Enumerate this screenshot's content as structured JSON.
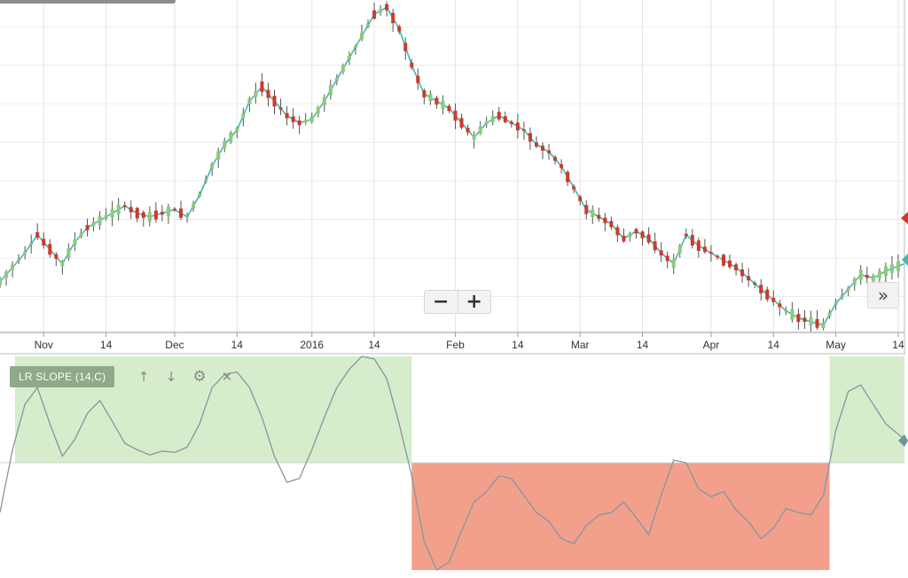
{
  "chart_data": [
    {
      "type": "candlestick",
      "ylim": [
        6,
        98
      ],
      "xlim": [
        0,
        145
      ],
      "grid": true,
      "x_ticks": [
        {
          "label": "Nov",
          "x": 7
        },
        {
          "label": "14",
          "x": 17
        },
        {
          "label": "Dec",
          "x": 28
        },
        {
          "label": "14",
          "x": 38
        },
        {
          "label": "2016",
          "x": 50
        },
        {
          "label": "14",
          "x": 60
        },
        {
          "label": "Feb",
          "x": 73
        },
        {
          "label": "14",
          "x": 83
        },
        {
          "label": "Mar",
          "x": 93
        },
        {
          "label": "14",
          "x": 103
        },
        {
          "label": "Apr",
          "x": 114
        },
        {
          "label": "14",
          "x": 124
        },
        {
          "label": "May",
          "x": 134
        },
        {
          "label": "14",
          "x": 144
        }
      ],
      "close_points": [
        [
          0,
          20
        ],
        [
          2,
          24
        ],
        [
          4,
          28
        ],
        [
          6,
          33
        ],
        [
          8,
          29
        ],
        [
          10,
          25
        ],
        [
          12,
          31
        ],
        [
          14,
          35
        ],
        [
          16,
          37
        ],
        [
          18,
          39
        ],
        [
          20,
          41
        ],
        [
          22,
          39
        ],
        [
          24,
          38
        ],
        [
          26,
          39
        ],
        [
          28,
          40
        ],
        [
          30,
          38
        ],
        [
          32,
          44
        ],
        [
          34,
          52
        ],
        [
          36,
          58
        ],
        [
          38,
          62
        ],
        [
          40,
          70
        ],
        [
          42,
          74
        ],
        [
          44,
          70
        ],
        [
          46,
          66
        ],
        [
          48,
          64
        ],
        [
          50,
          65
        ],
        [
          52,
          70
        ],
        [
          54,
          76
        ],
        [
          56,
          82
        ],
        [
          58,
          88
        ],
        [
          60,
          94
        ],
        [
          62,
          96
        ],
        [
          64,
          90
        ],
        [
          66,
          80
        ],
        [
          68,
          72
        ],
        [
          70,
          70
        ],
        [
          72,
          68
        ],
        [
          74,
          64
        ],
        [
          76,
          60
        ],
        [
          78,
          64
        ],
        [
          80,
          66
        ],
        [
          82,
          64
        ],
        [
          84,
          62
        ],
        [
          86,
          58
        ],
        [
          88,
          56
        ],
        [
          90,
          52
        ],
        [
          92,
          46
        ],
        [
          94,
          40
        ],
        [
          96,
          38
        ],
        [
          98,
          36
        ],
        [
          100,
          32
        ],
        [
          102,
          34
        ],
        [
          104,
          32
        ],
        [
          106,
          28
        ],
        [
          108,
          25
        ],
        [
          110,
          33
        ],
        [
          112,
          30
        ],
        [
          114,
          28
        ],
        [
          116,
          26
        ],
        [
          118,
          24
        ],
        [
          120,
          21
        ],
        [
          122,
          18
        ],
        [
          124,
          15
        ],
        [
          126,
          12
        ],
        [
          128,
          10
        ],
        [
          130,
          9
        ],
        [
          132,
          8
        ],
        [
          134,
          14
        ],
        [
          136,
          18
        ],
        [
          138,
          22
        ],
        [
          140,
          21
        ],
        [
          142,
          23
        ],
        [
          145,
          25
        ]
      ],
      "indicator": {
        "zero_line": 0,
        "ylim": [
          -82,
          82
        ],
        "green_band": {
          "from": 0,
          "to": 82
        },
        "red_band": {
          "from": 0,
          "to": -82
        },
        "red_period": [
          66,
          133
        ],
        "points": [
          [
            0,
            -38
          ],
          [
            2,
            10
          ],
          [
            4,
            45
          ],
          [
            6,
            58
          ],
          [
            8,
            30
          ],
          [
            10,
            5
          ],
          [
            12,
            18
          ],
          [
            14,
            38
          ],
          [
            16,
            48
          ],
          [
            18,
            32
          ],
          [
            20,
            15
          ],
          [
            22,
            10
          ],
          [
            24,
            6
          ],
          [
            26,
            9
          ],
          [
            28,
            8
          ],
          [
            30,
            12
          ],
          [
            32,
            30
          ],
          [
            34,
            58
          ],
          [
            36,
            68
          ],
          [
            38,
            70
          ],
          [
            40,
            58
          ],
          [
            42,
            35
          ],
          [
            44,
            5
          ],
          [
            46,
            -15
          ],
          [
            48,
            -12
          ],
          [
            50,
            10
          ],
          [
            52,
            35
          ],
          [
            54,
            58
          ],
          [
            56,
            72
          ],
          [
            58,
            82
          ],
          [
            60,
            80
          ],
          [
            62,
            65
          ],
          [
            64,
            30
          ],
          [
            66,
            -10
          ],
          [
            68,
            -60
          ],
          [
            70,
            -82
          ],
          [
            72,
            -76
          ],
          [
            74,
            -52
          ],
          [
            76,
            -30
          ],
          [
            78,
            -22
          ],
          [
            80,
            -10
          ],
          [
            82,
            -12
          ],
          [
            84,
            -25
          ],
          [
            86,
            -38
          ],
          [
            88,
            -45
          ],
          [
            90,
            -58
          ],
          [
            92,
            -62
          ],
          [
            94,
            -48
          ],
          [
            96,
            -40
          ],
          [
            98,
            -38
          ],
          [
            100,
            -30
          ],
          [
            102,
            -42
          ],
          [
            104,
            -55
          ],
          [
            106,
            -25
          ],
          [
            108,
            2
          ],
          [
            110,
            0
          ],
          [
            112,
            -20
          ],
          [
            114,
            -26
          ],
          [
            116,
            -22
          ],
          [
            118,
            -36
          ],
          [
            120,
            -45
          ],
          [
            122,
            -58
          ],
          [
            124,
            -50
          ],
          [
            126,
            -35
          ],
          [
            128,
            -38
          ],
          [
            130,
            -40
          ],
          [
            132,
            -25
          ],
          [
            134,
            25
          ],
          [
            136,
            55
          ],
          [
            138,
            60
          ],
          [
            140,
            45
          ],
          [
            142,
            30
          ],
          [
            145,
            18
          ]
        ]
      },
      "colors": {
        "up": "#8ec97b",
        "down": "#cb3b2c",
        "ma": "#3fb9b0",
        "green_band": "#d6eccb",
        "red_band": "#f2a08c",
        "indicator_line": "#8696a0",
        "marker_red": "#cf3a27",
        "marker_teal": "#3fb9b0",
        "marker_slate": "#6f96a0"
      }
    }
  ],
  "toolbar": {
    "zoom_out_label": "−",
    "zoom_in_label": "+",
    "scroll_forward_label": "»"
  },
  "study": {
    "label": "LR SLOPE (14,C)",
    "up_label": "↑",
    "down_label": "↓",
    "settings_label": "⚙",
    "close_label": "✕"
  },
  "icons": [
    "minus-icon",
    "plus-icon",
    "double-chevron-right-icon",
    "arrow-up-icon",
    "arrow-down-icon",
    "gear-icon",
    "close-icon"
  ]
}
